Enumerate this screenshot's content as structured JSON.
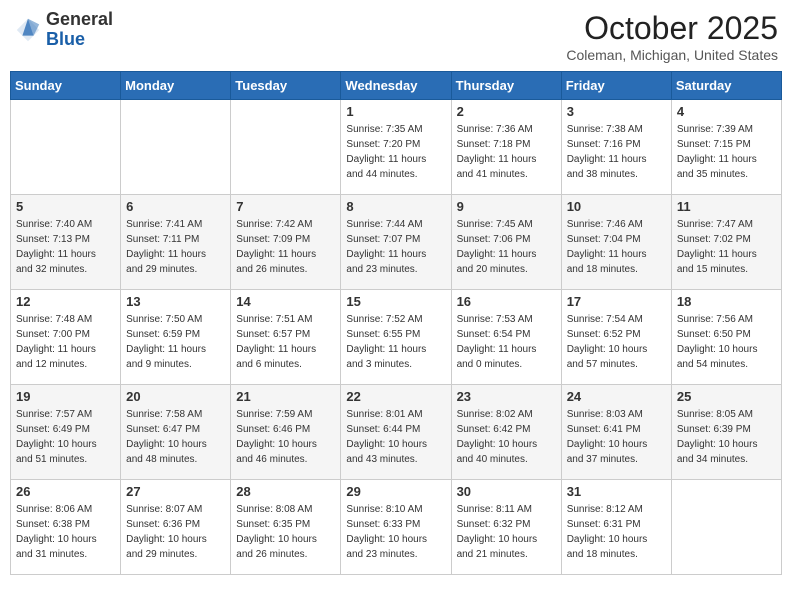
{
  "header": {
    "logo_general": "General",
    "logo_blue": "Blue",
    "title": "October 2025",
    "location": "Coleman, Michigan, United States"
  },
  "days_of_week": [
    "Sunday",
    "Monday",
    "Tuesday",
    "Wednesday",
    "Thursday",
    "Friday",
    "Saturday"
  ],
  "weeks": [
    [
      {
        "day": "",
        "info": ""
      },
      {
        "day": "",
        "info": ""
      },
      {
        "day": "",
        "info": ""
      },
      {
        "day": "1",
        "info": "Sunrise: 7:35 AM\nSunset: 7:20 PM\nDaylight: 11 hours and 44 minutes."
      },
      {
        "day": "2",
        "info": "Sunrise: 7:36 AM\nSunset: 7:18 PM\nDaylight: 11 hours and 41 minutes."
      },
      {
        "day": "3",
        "info": "Sunrise: 7:38 AM\nSunset: 7:16 PM\nDaylight: 11 hours and 38 minutes."
      },
      {
        "day": "4",
        "info": "Sunrise: 7:39 AM\nSunset: 7:15 PM\nDaylight: 11 hours and 35 minutes."
      }
    ],
    [
      {
        "day": "5",
        "info": "Sunrise: 7:40 AM\nSunset: 7:13 PM\nDaylight: 11 hours and 32 minutes."
      },
      {
        "day": "6",
        "info": "Sunrise: 7:41 AM\nSunset: 7:11 PM\nDaylight: 11 hours and 29 minutes."
      },
      {
        "day": "7",
        "info": "Sunrise: 7:42 AM\nSunset: 7:09 PM\nDaylight: 11 hours and 26 minutes."
      },
      {
        "day": "8",
        "info": "Sunrise: 7:44 AM\nSunset: 7:07 PM\nDaylight: 11 hours and 23 minutes."
      },
      {
        "day": "9",
        "info": "Sunrise: 7:45 AM\nSunset: 7:06 PM\nDaylight: 11 hours and 20 minutes."
      },
      {
        "day": "10",
        "info": "Sunrise: 7:46 AM\nSunset: 7:04 PM\nDaylight: 11 hours and 18 minutes."
      },
      {
        "day": "11",
        "info": "Sunrise: 7:47 AM\nSunset: 7:02 PM\nDaylight: 11 hours and 15 minutes."
      }
    ],
    [
      {
        "day": "12",
        "info": "Sunrise: 7:48 AM\nSunset: 7:00 PM\nDaylight: 11 hours and 12 minutes."
      },
      {
        "day": "13",
        "info": "Sunrise: 7:50 AM\nSunset: 6:59 PM\nDaylight: 11 hours and 9 minutes."
      },
      {
        "day": "14",
        "info": "Sunrise: 7:51 AM\nSunset: 6:57 PM\nDaylight: 11 hours and 6 minutes."
      },
      {
        "day": "15",
        "info": "Sunrise: 7:52 AM\nSunset: 6:55 PM\nDaylight: 11 hours and 3 minutes."
      },
      {
        "day": "16",
        "info": "Sunrise: 7:53 AM\nSunset: 6:54 PM\nDaylight: 11 hours and 0 minutes."
      },
      {
        "day": "17",
        "info": "Sunrise: 7:54 AM\nSunset: 6:52 PM\nDaylight: 10 hours and 57 minutes."
      },
      {
        "day": "18",
        "info": "Sunrise: 7:56 AM\nSunset: 6:50 PM\nDaylight: 10 hours and 54 minutes."
      }
    ],
    [
      {
        "day": "19",
        "info": "Sunrise: 7:57 AM\nSunset: 6:49 PM\nDaylight: 10 hours and 51 minutes."
      },
      {
        "day": "20",
        "info": "Sunrise: 7:58 AM\nSunset: 6:47 PM\nDaylight: 10 hours and 48 minutes."
      },
      {
        "day": "21",
        "info": "Sunrise: 7:59 AM\nSunset: 6:46 PM\nDaylight: 10 hours and 46 minutes."
      },
      {
        "day": "22",
        "info": "Sunrise: 8:01 AM\nSunset: 6:44 PM\nDaylight: 10 hours and 43 minutes."
      },
      {
        "day": "23",
        "info": "Sunrise: 8:02 AM\nSunset: 6:42 PM\nDaylight: 10 hours and 40 minutes."
      },
      {
        "day": "24",
        "info": "Sunrise: 8:03 AM\nSunset: 6:41 PM\nDaylight: 10 hours and 37 minutes."
      },
      {
        "day": "25",
        "info": "Sunrise: 8:05 AM\nSunset: 6:39 PM\nDaylight: 10 hours and 34 minutes."
      }
    ],
    [
      {
        "day": "26",
        "info": "Sunrise: 8:06 AM\nSunset: 6:38 PM\nDaylight: 10 hours and 31 minutes."
      },
      {
        "day": "27",
        "info": "Sunrise: 8:07 AM\nSunset: 6:36 PM\nDaylight: 10 hours and 29 minutes."
      },
      {
        "day": "28",
        "info": "Sunrise: 8:08 AM\nSunset: 6:35 PM\nDaylight: 10 hours and 26 minutes."
      },
      {
        "day": "29",
        "info": "Sunrise: 8:10 AM\nSunset: 6:33 PM\nDaylight: 10 hours and 23 minutes."
      },
      {
        "day": "30",
        "info": "Sunrise: 8:11 AM\nSunset: 6:32 PM\nDaylight: 10 hours and 21 minutes."
      },
      {
        "day": "31",
        "info": "Sunrise: 8:12 AM\nSunset: 6:31 PM\nDaylight: 10 hours and 18 minutes."
      },
      {
        "day": "",
        "info": ""
      }
    ]
  ]
}
